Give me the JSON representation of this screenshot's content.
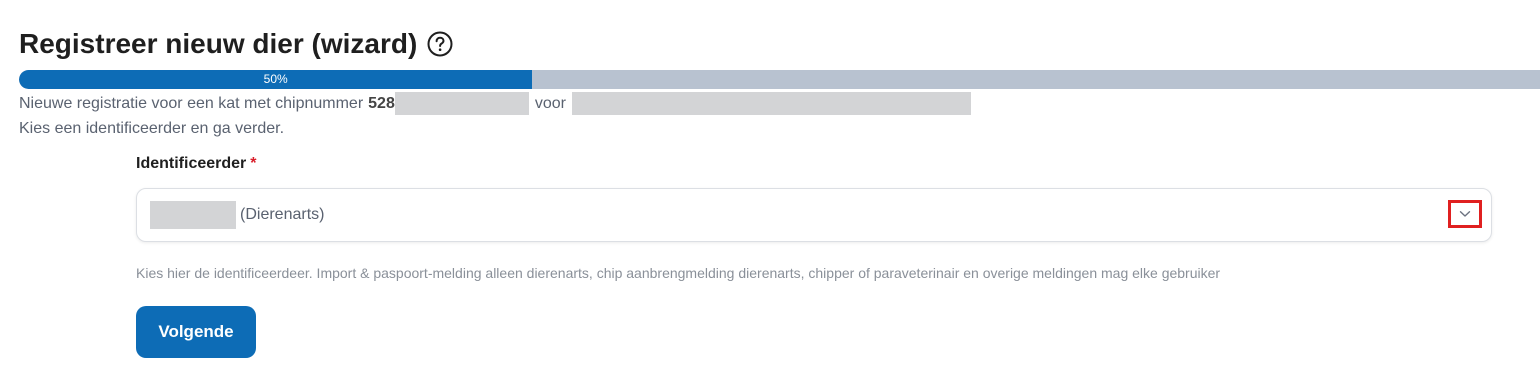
{
  "page": {
    "title": "Registreer nieuw dier (wizard)",
    "help_icon": "question-circle-icon"
  },
  "progress": {
    "percent": 50,
    "label": "50%",
    "bar_color": "#0d6cb6",
    "track_color": "#b8c2d0"
  },
  "intro": {
    "line1_prefix": "Nieuwe registratie voor een kat met chipnummer",
    "chip_prefix": "528",
    "line1_middle": "voor",
    "line2": "Kies een identificeerder en ga verder."
  },
  "identifier_field": {
    "label": "Identificeerder",
    "required_mark": "*",
    "selected_value": "(Dierenarts)",
    "toggle_icon": "chevron-down-icon",
    "help_text": "Kies hier de identificeerdeer. Import & paspoort-melding alleen dierenarts, chip aanbrengmelding dierenarts, chipper of paraveterinair en overige meldingen mag elke gebruiker"
  },
  "actions": {
    "next_label": "Volgende"
  },
  "colors": {
    "primary": "#0d6cb6",
    "required": "#d91e2a",
    "highlight_box": "#e02020"
  }
}
